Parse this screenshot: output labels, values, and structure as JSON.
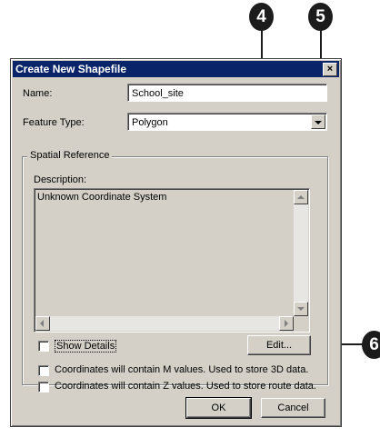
{
  "callouts": {
    "c4": "4",
    "c5": "5",
    "c6": "6"
  },
  "dialog": {
    "title": "Create New Shapefile",
    "close_glyph": "×",
    "name_label": "Name:",
    "name_value": "School_site",
    "feature_type_label": "Feature Type:",
    "feature_type_value": "Polygon",
    "spatial_reference_label": "Spatial Reference",
    "description_label": "Description:",
    "description_value": "Unknown Coordinate System",
    "show_details_label": "Show Details",
    "edit_button": "Edit...",
    "m_values_label": "Coordinates will contain M values. Used to store 3D data.",
    "z_values_label": "Coordinates will contain Z values. Used to store route data.",
    "ok_button": "OK",
    "cancel_button": "Cancel"
  },
  "colors": {
    "title_bar": "#0a246a",
    "dialog_bg": "#d4d0c8",
    "callout": "#1c1c1c"
  }
}
